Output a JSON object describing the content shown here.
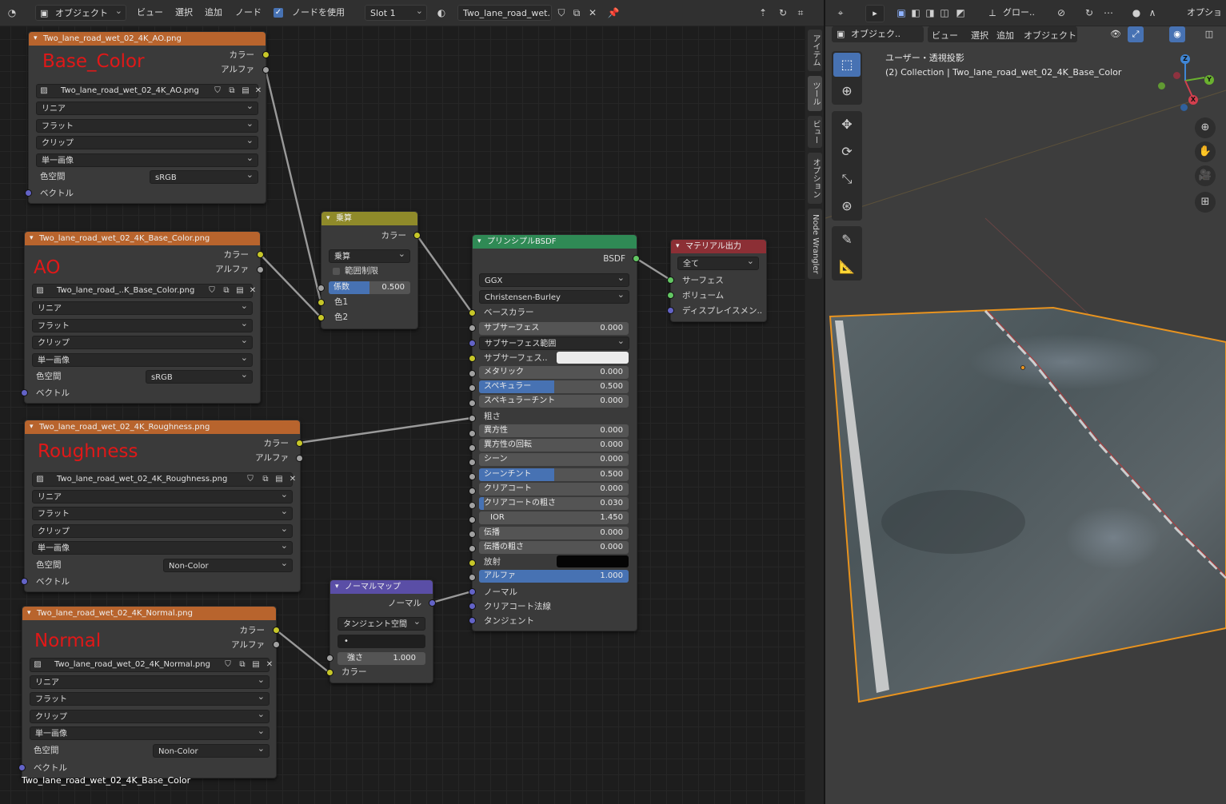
{
  "node_header": {
    "mode": "オブジェクト",
    "menu": [
      "ビュー",
      "選択",
      "追加",
      "ノード"
    ],
    "use_nodes_label": "ノードを使用",
    "slot": "Slot 1",
    "material": "Two_lane_road_wet.."
  },
  "viewport_header": {
    "orientation": "グロー..",
    "options_label": "オプショ",
    "mode": "オブジェク..",
    "menu": [
      "ビュー",
      "選択",
      "追加",
      "オブジェクト"
    ]
  },
  "sidebar_tabs": [
    "アイテム",
    "ツール",
    "ビュー",
    "オプション",
    "Node Wrangler"
  ],
  "viewport": {
    "projection": "ユーザー・透視投影",
    "collection": "(2) Collection | Two_lane_road_wet_02_4K_Base_Color",
    "axes": [
      "Z",
      "Y",
      "X"
    ]
  },
  "tex_nodes": [
    {
      "title": "Two_lane_road_wet_02_4K_AO.png",
      "label": "Base_Color",
      "image": "Two_lane_road_wet_02_4K_AO.png",
      "interp": "リニア",
      "proj": "フラット",
      "ext": "クリップ",
      "src": "単一画像",
      "cs_label": "色空間",
      "cs": "sRGB",
      "out_color": "カラー",
      "out_alpha": "アルファ",
      "in_vec": "ベクトル"
    },
    {
      "title": "Two_lane_road_wet_02_4K_Base_Color.png",
      "label": "AO",
      "image": "Two_lane_road_..K_Base_Color.png",
      "interp": "リニア",
      "proj": "フラット",
      "ext": "クリップ",
      "src": "単一画像",
      "cs_label": "色空間",
      "cs": "sRGB",
      "out_color": "カラー",
      "out_alpha": "アルファ",
      "in_vec": "ベクトル"
    },
    {
      "title": "Two_lane_road_wet_02_4K_Roughness.png",
      "label": "Roughness",
      "image": "Two_lane_road_wet_02_4K_Roughness.png",
      "interp": "リニア",
      "proj": "フラット",
      "ext": "クリップ",
      "src": "単一画像",
      "cs_label": "色空間",
      "cs": "Non-Color",
      "out_color": "カラー",
      "out_alpha": "アルファ",
      "in_vec": "ベクトル"
    },
    {
      "title": "Two_lane_road_wet_02_4K_Normal.png",
      "label": "Normal",
      "image": "Two_lane_road_wet_02_4K_Normal.png",
      "interp": "リニア",
      "proj": "フラット",
      "ext": "クリップ",
      "src": "単一画像",
      "cs_label": "色空間",
      "cs": "Non-Color",
      "out_color": "カラー",
      "out_alpha": "アルファ",
      "in_vec": "ベクトル"
    }
  ],
  "math_node": {
    "title": "乗算",
    "out": "カラー",
    "op": "乗算",
    "clamp": "範囲制限",
    "fac_label": "係数",
    "fac": "0.500",
    "c1": "色1",
    "c2": "色2"
  },
  "bsdf": {
    "title": "プリンシプルBSDF",
    "out": "BSDF",
    "dist": "GGX",
    "sss_method": "Christensen-Burley",
    "base_color": "ベースカラー",
    "rows": [
      {
        "label": "サブサーフェス",
        "value": "0.000",
        "fill": 0
      },
      {
        "label": "サブサーフェス範囲",
        "value": "",
        "fill": 0
      },
      {
        "label": "サブサーフェス..",
        "value": "",
        "fill": 0
      },
      {
        "label": "メタリック",
        "value": "0.000",
        "fill": 0
      },
      {
        "label": "スペキュラー",
        "value": "0.500",
        "fill": 0.5
      },
      {
        "label": "スペキュラーチント",
        "value": "0.000",
        "fill": 0
      },
      {
        "label": "粗さ",
        "value": "",
        "fill": 0
      },
      {
        "label": "異方性",
        "value": "0.000",
        "fill": 0
      },
      {
        "label": "異方性の回転",
        "value": "0.000",
        "fill": 0
      },
      {
        "label": "シーン",
        "value": "0.000",
        "fill": 0
      },
      {
        "label": "シーンチント",
        "value": "0.500",
        "fill": 0.5
      },
      {
        "label": "クリアコート",
        "value": "0.000",
        "fill": 0
      },
      {
        "label": "クリアコートの粗さ",
        "value": "0.030",
        "fill": 0.03
      },
      {
        "label": "IOR",
        "value": "1.450",
        "fill": 0
      },
      {
        "label": "伝播",
        "value": "0.000",
        "fill": 0
      },
      {
        "label": "伝播の粗さ",
        "value": "0.000",
        "fill": 0
      },
      {
        "label": "放射",
        "value": "",
        "fill": 0
      },
      {
        "label": "アルファ",
        "value": "1.000",
        "fill": 1
      }
    ],
    "normal": "ノーマル",
    "cc_normal": "クリアコート法線",
    "tangent": "タンジェント"
  },
  "output_node": {
    "title": "マテリアル出力",
    "target": "全て",
    "surface": "サーフェス",
    "volume": "ボリューム",
    "disp": "ディスプレイスメン.."
  },
  "normal_node": {
    "title": "ノーマルマップ",
    "out": "ノーマル",
    "space": "タンジェント空間",
    "uv": "•",
    "strength_label": "強さ",
    "strength": "1.000",
    "color": "カラー"
  },
  "footer_name": "Two_lane_road_wet_02_4K_Base_Color"
}
